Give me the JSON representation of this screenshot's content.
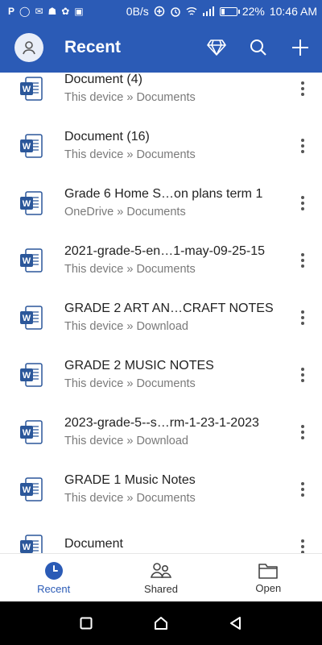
{
  "status_bar": {
    "left_glyphs": [
      "P",
      "◯",
      "✉",
      "☗",
      "✿",
      "▣"
    ],
    "net_speed": "0B/s",
    "battery_text": "22%",
    "battery_level": 0.22,
    "time": "10:46 AM"
  },
  "header": {
    "title": "Recent",
    "avatar_icon": "person-icon",
    "actions": [
      "premium-diamond-icon",
      "search-icon",
      "add-icon"
    ]
  },
  "files": [
    {
      "name": "Document (4)",
      "path": "This device » Documents"
    },
    {
      "name": "Document (16)",
      "path": "This device » Documents"
    },
    {
      "name": "Grade 6 Home S…on plans term 1",
      "path": "OneDrive » Documents"
    },
    {
      "name": "2021-grade-5-en…1-may-09-25-15",
      "path": "This device » Documents"
    },
    {
      "name": "GRADE 2 ART AN…CRAFT NOTES",
      "path": "This device » Download"
    },
    {
      "name": "GRADE 2 MUSIC NOTES",
      "path": "This device » Documents"
    },
    {
      "name": "2023-grade-5--s…rm-1-23-1-2023",
      "path": "This device » Download"
    },
    {
      "name": "GRADE 1 Music Notes",
      "path": "This device » Documents"
    },
    {
      "name": "Document",
      "path": ""
    }
  ],
  "bottom_nav": [
    {
      "label": "Recent",
      "icon": "clock-icon",
      "active": true
    },
    {
      "label": "Shared",
      "icon": "people-icon",
      "active": false
    },
    {
      "label": "Open",
      "icon": "folder-icon",
      "active": false
    }
  ],
  "colors": {
    "brand_blue": "#2b5bb6",
    "word_blue": "#2b579a"
  }
}
